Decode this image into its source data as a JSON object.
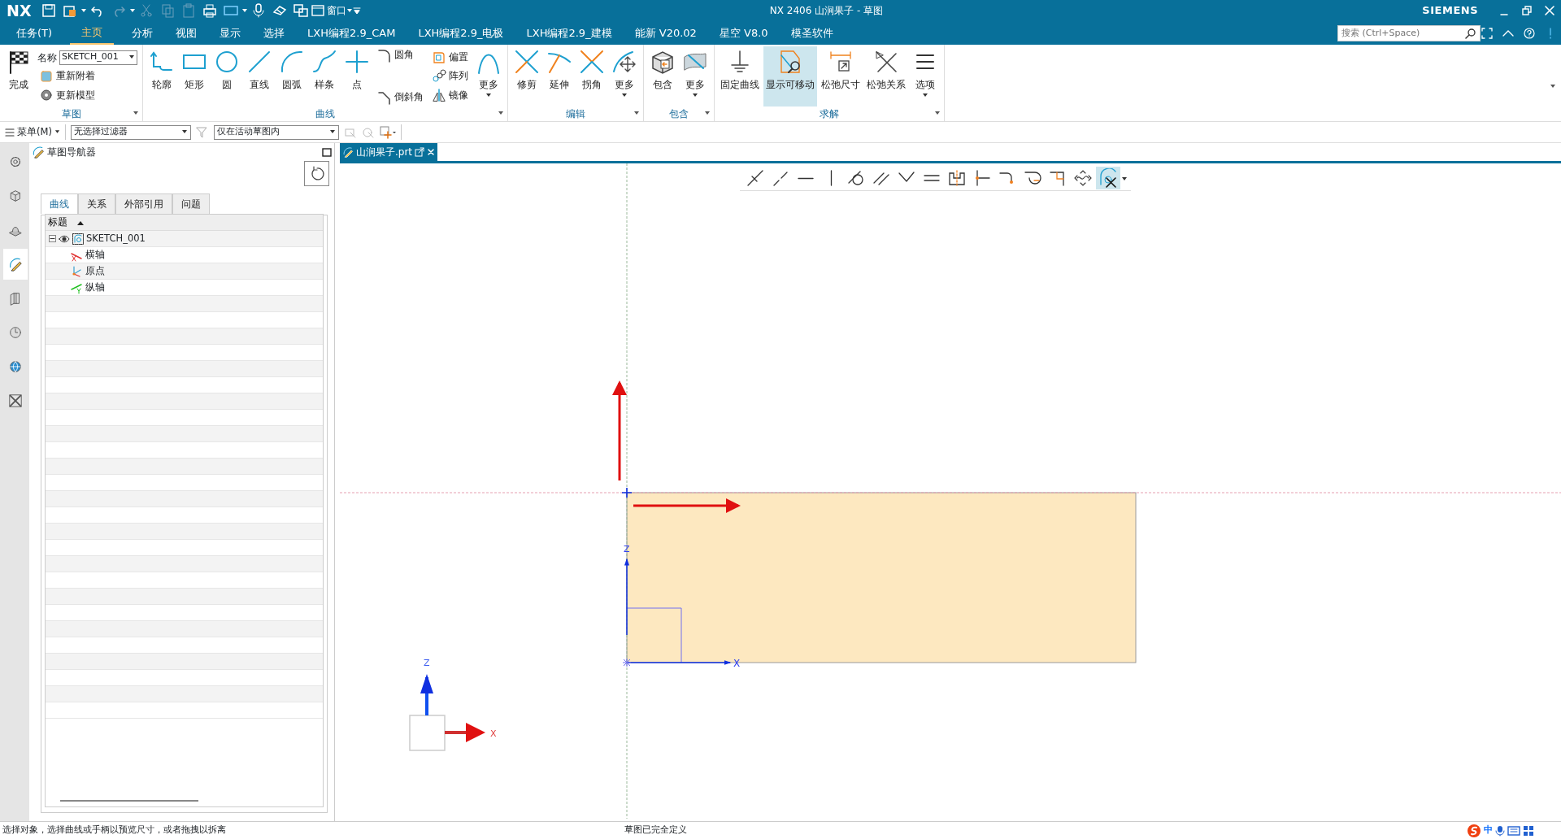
{
  "window": {
    "logo": "NX",
    "title": "NX 2406 山涧果子 - 草图",
    "brand": "SIEMENS",
    "quick_window_menu": "窗口"
  },
  "menu_tabs": [
    {
      "label": "任务(T)",
      "selected": false
    },
    {
      "label": "主页",
      "selected": true
    },
    {
      "label": "分析",
      "selected": false
    },
    {
      "label": "视图",
      "selected": false
    },
    {
      "label": "显示",
      "selected": false
    },
    {
      "label": "选择",
      "selected": false
    },
    {
      "label": "LXH编程2.9_CAM",
      "selected": false
    },
    {
      "label": "LXH编程2.9_电极",
      "selected": false
    },
    {
      "label": "LXH编程2.9_建模",
      "selected": false
    },
    {
      "label": "能新 V20.02",
      "selected": false
    },
    {
      "label": "星空 V8.0",
      "selected": false
    },
    {
      "label": "模圣软件",
      "selected": false
    }
  ],
  "search": {
    "placeholder": "搜索 (Ctrl+Space)"
  },
  "ribbon_groups": [
    {
      "label": "草图",
      "columns": [
        {
          "kind": "large",
          "label": "完成",
          "dropdown": false,
          "selected": false
        },
        {
          "kind": "stack",
          "items": [
            {
              "kind": "field",
              "label": "名称",
              "value": "SKETCH_001"
            },
            {
              "kind": "button",
              "label": "重新附着"
            },
            {
              "kind": "button",
              "label": "更新模型"
            }
          ]
        }
      ]
    },
    {
      "label": "曲线",
      "columns": [
        {
          "kind": "large",
          "label": "轮廓",
          "dropdown": false,
          "selected": false
        },
        {
          "kind": "large",
          "label": "矩形",
          "dropdown": false,
          "selected": false
        },
        {
          "kind": "large",
          "label": "圆",
          "dropdown": false,
          "selected": false
        },
        {
          "kind": "large",
          "label": "直线",
          "dropdown": false,
          "selected": false
        },
        {
          "kind": "large",
          "label": "圆弧",
          "dropdown": false,
          "selected": false
        },
        {
          "kind": "large",
          "label": "样条",
          "dropdown": false,
          "selected": false
        },
        {
          "kind": "large",
          "label": "点",
          "dropdown": false,
          "selected": false
        },
        {
          "kind": "stack",
          "items": [
            {
              "kind": "button",
              "label": "圆角"
            },
            {
              "kind": "button",
              "label": "倒斜角"
            }
          ]
        },
        {
          "kind": "stack",
          "items": [
            {
              "kind": "button",
              "label": "偏置"
            },
            {
              "kind": "button",
              "label": "阵列"
            },
            {
              "kind": "button",
              "label": "镜像"
            }
          ]
        },
        {
          "kind": "large",
          "label": "更多",
          "dropdown": true,
          "selected": false
        }
      ]
    },
    {
      "label": "编辑",
      "columns": [
        {
          "kind": "large",
          "label": "修剪",
          "dropdown": false,
          "selected": false
        },
        {
          "kind": "large",
          "label": "延伸",
          "dropdown": false,
          "selected": false
        },
        {
          "kind": "large",
          "label": "拐角",
          "dropdown": false,
          "selected": false
        },
        {
          "kind": "large",
          "label": "更多",
          "dropdown": true,
          "selected": false
        }
      ]
    },
    {
      "label": "包含",
      "columns": [
        {
          "kind": "large",
          "label": "包含",
          "dropdown": false,
          "selected": false
        },
        {
          "kind": "large",
          "label": "更多",
          "dropdown": true,
          "selected": false
        }
      ]
    },
    {
      "label": "求解",
      "columns": [
        {
          "kind": "large",
          "label": "固定曲线",
          "dropdown": false,
          "selected": false
        },
        {
          "kind": "large",
          "label": "显示可移动",
          "dropdown": false,
          "selected": true
        },
        {
          "kind": "large",
          "label": "松弛尺寸",
          "dropdown": false,
          "selected": false
        },
        {
          "kind": "large",
          "label": "松弛关系",
          "dropdown": false,
          "selected": false
        },
        {
          "kind": "large",
          "label": "选项",
          "dropdown": true,
          "selected": false
        }
      ]
    }
  ],
  "toolbar": {
    "menu": "菜单(M)",
    "filter": "无选择过滤器",
    "scope": "仅在活动草图内"
  },
  "side_tabs": [
    {
      "selected": false
    },
    {
      "selected": false
    },
    {
      "selected": false
    },
    {
      "selected": true
    },
    {
      "selected": false
    },
    {
      "selected": false
    },
    {
      "selected": false
    },
    {
      "selected": false
    }
  ],
  "navigator": {
    "title": "草图导航器",
    "tabs": [
      {
        "label": "曲线",
        "selected": true
      },
      {
        "label": "关系",
        "selected": false
      },
      {
        "label": "外部引用",
        "selected": false
      },
      {
        "label": "问题",
        "selected": false
      }
    ],
    "column": "标题",
    "tree": [
      {
        "label": "SKETCH_001",
        "expanded": true,
        "children": [
          {
            "label": "横轴"
          },
          {
            "label": "原点"
          },
          {
            "label": "纵轴"
          }
        ]
      }
    ]
  },
  "document_tab": {
    "label": "山涧果子.prt"
  },
  "constraint_toolbar": [
    {
      "selected": false
    },
    {
      "selected": false
    },
    {
      "selected": false
    },
    {
      "selected": false
    },
    {
      "selected": false
    },
    {
      "selected": false
    },
    {
      "selected": false
    },
    {
      "selected": false
    },
    {
      "selected": false
    },
    {
      "selected": false
    },
    {
      "selected": false
    },
    {
      "selected": false
    },
    {
      "selected": false
    },
    {
      "selected": false
    },
    {
      "selected": true
    }
  ],
  "canvas": {
    "sketch_axes": {
      "x_label": "X",
      "z_label": "Z"
    },
    "view_triad": {
      "x_label": "X",
      "z_label": "Z"
    }
  },
  "status_bar": {
    "prompt": "选择对象，选择曲线或手柄以预览尺寸，或者拖拽以拆离",
    "status": "草图已完全定义",
    "ime": "中"
  }
}
